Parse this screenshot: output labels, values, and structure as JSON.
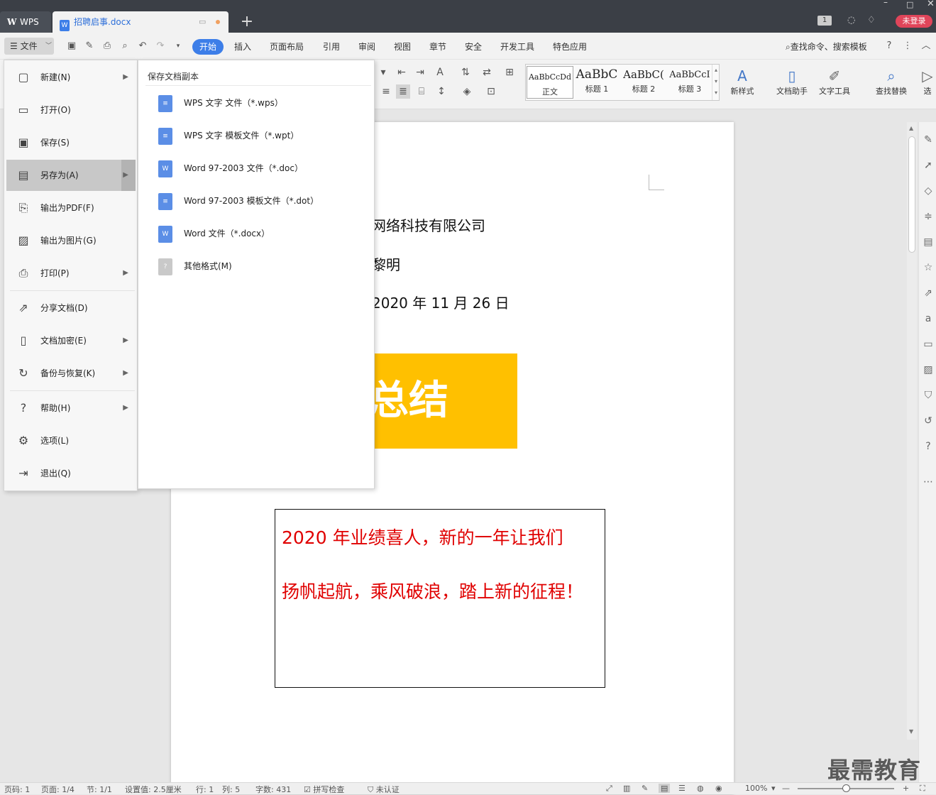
{
  "titlebar": {
    "app_tab": "WPS",
    "doc_tab": "招聘启事.docx",
    "login": "未登录",
    "badge": "1"
  },
  "menubar": {
    "file": "文件",
    "tabs": [
      "开始",
      "插入",
      "页面布局",
      "引用",
      "审阅",
      "视图",
      "章节",
      "安全",
      "开发工具",
      "特色应用"
    ],
    "search": "查找命令、搜索模板"
  },
  "ribbon": {
    "styles": [
      {
        "sample": "AaBbCcDd",
        "name": "正文"
      },
      {
        "sample": "AaBbC",
        "name": "标题 1"
      },
      {
        "sample": "AaBbC(",
        "name": "标题 2"
      },
      {
        "sample": "AaBbCcI",
        "name": "标题 3"
      }
    ],
    "new_style": "新样式",
    "doc_helper": "文档助手",
    "text_tools": "文字工具",
    "find_replace": "查找替换",
    "select": "选"
  },
  "filemenu": {
    "items": [
      {
        "label": "新建(N)",
        "icon": "new-doc-icon",
        "arrow": true
      },
      {
        "label": "打开(O)",
        "icon": "folder-icon",
        "arrow": false
      },
      {
        "label": "保存(S)",
        "icon": "save-icon",
        "arrow": false
      },
      {
        "label": "另存为(A)",
        "icon": "save-as-icon",
        "arrow": true
      },
      {
        "label": "输出为PDF(F)",
        "icon": "pdf-icon",
        "arrow": false
      },
      {
        "label": "输出为图片(G)",
        "icon": "image-icon",
        "arrow": false
      },
      {
        "label": "打印(P)",
        "icon": "print-icon",
        "arrow": true
      },
      {
        "label": "分享文档(D)",
        "icon": "share-icon",
        "arrow": false
      },
      {
        "label": "文档加密(E)",
        "icon": "lock-icon",
        "arrow": true
      },
      {
        "label": "备份与恢复(K)",
        "icon": "backup-icon",
        "arrow": true
      },
      {
        "label": "帮助(H)",
        "icon": "help-icon",
        "arrow": true
      },
      {
        "label": "选项(L)",
        "icon": "gear-icon",
        "arrow": false
      },
      {
        "label": "退出(Q)",
        "icon": "exit-icon",
        "arrow": false
      }
    ]
  },
  "submenu": {
    "title": "保存文档副本",
    "items": [
      {
        "label": "WPS 文字 文件（*.wps）",
        "type": "wps"
      },
      {
        "label": "WPS 文字 模板文件（*.wpt）",
        "type": "wps"
      },
      {
        "label": "Word 97-2003 文件（*.doc）",
        "type": "word"
      },
      {
        "label": "Word 97-2003 模板文件（*.dot）",
        "type": "wps"
      },
      {
        "label": "Word 文件（*.docx）",
        "type": "word"
      },
      {
        "label": "其他格式(M)",
        "type": "other"
      }
    ]
  },
  "document": {
    "line1": "网络科技有限公司",
    "line2": "黎明",
    "line3": "2020 年 11 月 26 日",
    "banner": "总结",
    "textbox_line1": "2020 年业绩喜人，新的一年让我们",
    "textbox_line2": "扬帆起航，乘风破浪，踏上新的征程！"
  },
  "statusbar": {
    "page_num": "页码: 1",
    "pages": "页面: 1/4",
    "section": "节: 1/1",
    "setting": "设置值: 2.5厘米",
    "row": "行: 1",
    "col": "列: 5",
    "words": "字数: 431",
    "spell": "拼写检查",
    "cert": "未认证",
    "zoom": "100%",
    "zoom_value": 0.5
  },
  "watermark": "最需教育",
  "colors": {
    "accent": "#3d7ee8",
    "banner": "#ffc000",
    "textbox_text": "#e00000",
    "login": "#e0455a"
  }
}
